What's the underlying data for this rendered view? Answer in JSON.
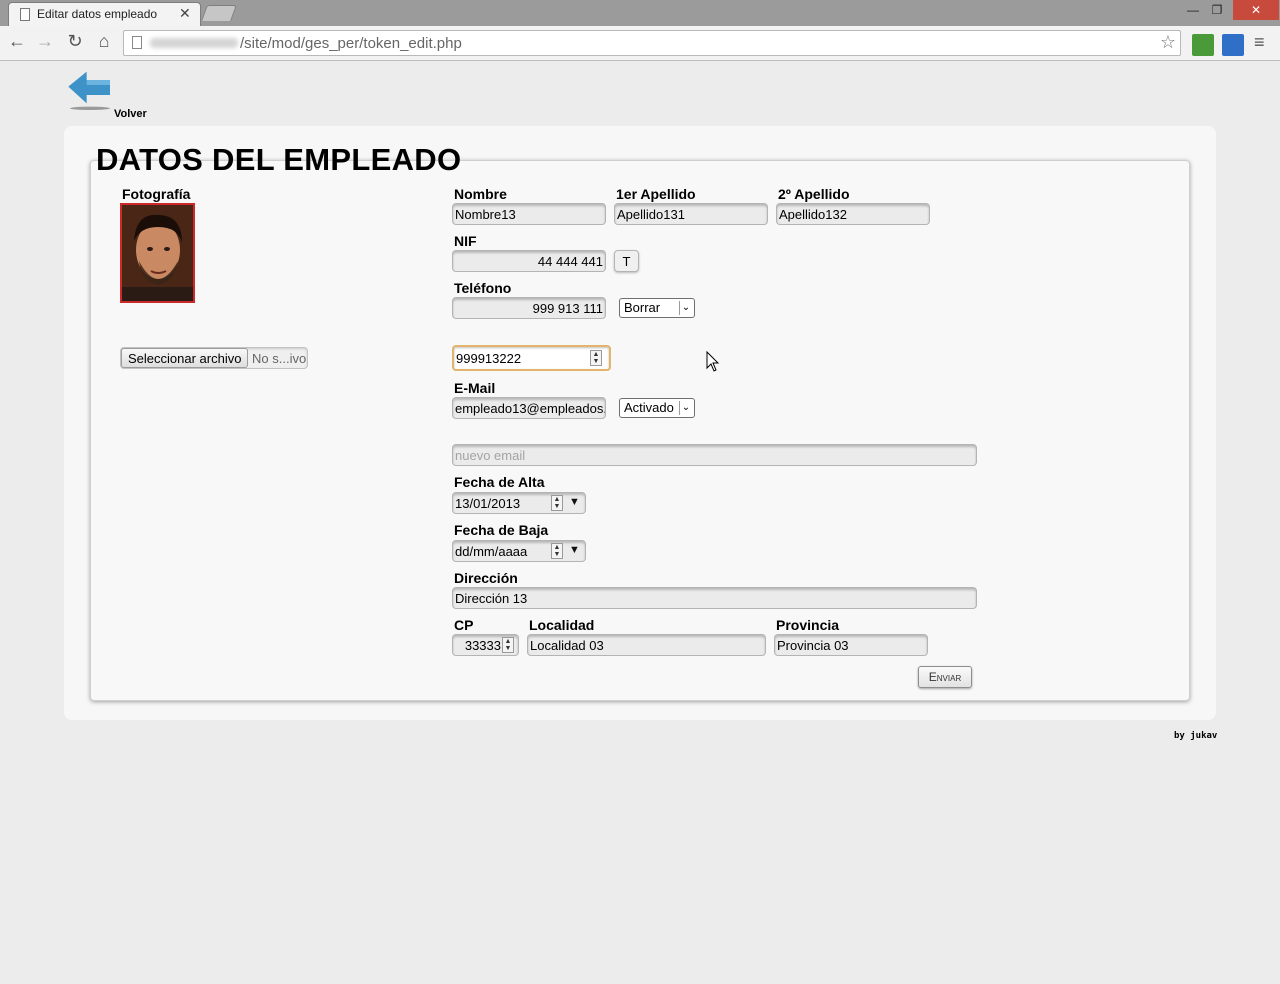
{
  "browser": {
    "tab_title": "Editar datos empleado",
    "tab_close": "✕",
    "url_path": "/site/mod/ges_per/token_edit.php",
    "win_min": "—",
    "win_max": "❐",
    "win_close": "✕",
    "menu": "≡"
  },
  "nav": {
    "back_label": "Volver"
  },
  "form": {
    "title": "DATOS DEL EMPLEADO",
    "photo_label": "Fotografía",
    "file_button": "Seleccionar archivo",
    "file_status": "No s...ivo",
    "nombre_label": "Nombre",
    "nombre": "Nombre13",
    "apellido1_label": "1er Apellido",
    "apellido1": "Apellido131",
    "apellido2_label": "2º Apellido",
    "apellido2": "Apellido132",
    "nif_label": "NIF",
    "nif": "44 444 441",
    "nif_letter": "T",
    "telefono_label": "Teléfono",
    "telefono": "999 913 111",
    "telefono_action": "Borrar",
    "telefono_new": "999913222",
    "email_label": "E-Mail",
    "email": "empleado13@empleados.",
    "email_status": "Activado",
    "email_new_placeholder": "nuevo email",
    "fecha_alta_label": "Fecha de Alta",
    "fecha_alta": "13/01/2013",
    "fecha_baja_label": "Fecha de Baja",
    "fecha_baja_placeholder": "dd/mm/aaaa",
    "direccion_label": "Dirección",
    "direccion": "Dirección 13",
    "cp_label": "CP",
    "cp": "33333",
    "localidad_label": "Localidad",
    "localidad": "Localidad 03",
    "provincia_label": "Provincia",
    "provincia": "Provincia 03",
    "submit": "Enviar"
  },
  "footer": {
    "credit": "by jukav"
  },
  "colors": {
    "arrow": "#3d92c8",
    "focus_border": "#e2b46c",
    "photo_border": "#cc2a2a",
    "close_btn": "#c74a3d"
  }
}
